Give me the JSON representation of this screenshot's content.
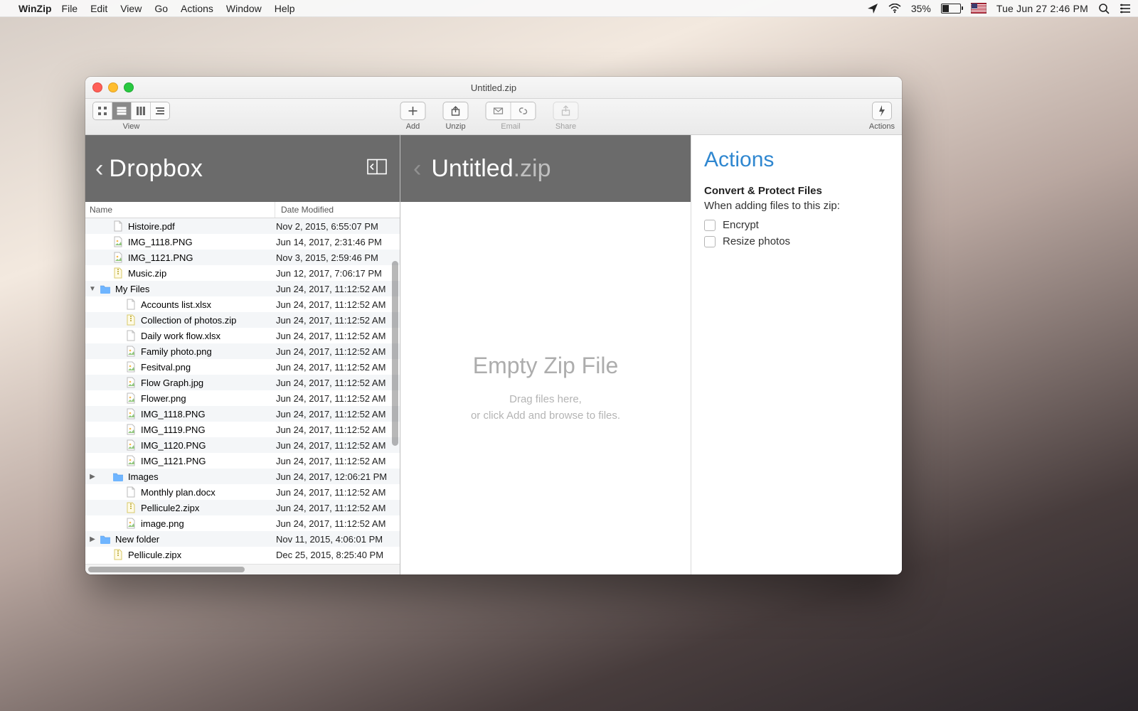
{
  "menubar": {
    "app": "WinZip",
    "items": [
      "File",
      "Edit",
      "View",
      "Go",
      "Actions",
      "Window",
      "Help"
    ],
    "battery_pct": "35%",
    "clock": "Tue Jun 27  2:46 PM"
  },
  "window": {
    "title": "Untitled.zip",
    "toolbar": {
      "view_label": "View",
      "add_label": "Add",
      "unzip_label": "Unzip",
      "email_label": "Email",
      "share_label": "Share",
      "actions_label": "Actions"
    },
    "browser": {
      "location": "Dropbox",
      "columns": {
        "name": "Name",
        "date": "Date Modified"
      },
      "rows": [
        {
          "indent": 1,
          "icon": "doc",
          "name": "Histoire.pdf",
          "date": "Nov 2, 2015, 6:55:07 PM"
        },
        {
          "indent": 1,
          "icon": "img",
          "name": "IMG_1118.PNG",
          "date": "Jun 14, 2017, 2:31:46 PM"
        },
        {
          "indent": 1,
          "icon": "img",
          "name": "IMG_1121.PNG",
          "date": "Nov 3, 2015, 2:59:46 PM"
        },
        {
          "indent": 1,
          "icon": "zip",
          "name": "Music.zip",
          "date": "Jun 12, 2017, 7:06:17 PM"
        },
        {
          "indent": 0,
          "disclosure": "down",
          "icon": "folder",
          "name": "My Files",
          "date": "Jun 24, 2017, 11:12:52 AM"
        },
        {
          "indent": 2,
          "icon": "doc",
          "name": "Accounts list.xlsx",
          "date": "Jun 24, 2017, 11:12:52 AM"
        },
        {
          "indent": 2,
          "icon": "zip",
          "name": "Collection of photos.zip",
          "date": "Jun 24, 2017, 11:12:52 AM"
        },
        {
          "indent": 2,
          "icon": "doc",
          "name": "Daily work flow.xlsx",
          "date": "Jun 24, 2017, 11:12:52 AM"
        },
        {
          "indent": 2,
          "icon": "img",
          "name": "Family photo.png",
          "date": "Jun 24, 2017, 11:12:52 AM"
        },
        {
          "indent": 2,
          "icon": "img",
          "name": "Fesitval.png",
          "date": "Jun 24, 2017, 11:12:52 AM"
        },
        {
          "indent": 2,
          "icon": "img",
          "name": "Flow Graph.jpg",
          "date": "Jun 24, 2017, 11:12:52 AM"
        },
        {
          "indent": 2,
          "icon": "img",
          "name": "Flower.png",
          "date": "Jun 24, 2017, 11:12:52 AM"
        },
        {
          "indent": 2,
          "icon": "img",
          "name": "IMG_1118.PNG",
          "date": "Jun 24, 2017, 11:12:52 AM"
        },
        {
          "indent": 2,
          "icon": "img",
          "name": "IMG_1119.PNG",
          "date": "Jun 24, 2017, 11:12:52 AM"
        },
        {
          "indent": 2,
          "icon": "img",
          "name": "IMG_1120.PNG",
          "date": "Jun 24, 2017, 11:12:52 AM"
        },
        {
          "indent": 2,
          "icon": "img",
          "name": "IMG_1121.PNG",
          "date": "Jun 24, 2017, 11:12:52 AM"
        },
        {
          "indent": 1,
          "disclosure": "right",
          "icon": "folder",
          "name": "Images",
          "date": "Jun 24, 2017, 12:06:21 PM"
        },
        {
          "indent": 2,
          "icon": "doc",
          "name": "Monthly plan.docx",
          "date": "Jun 24, 2017, 11:12:52 AM"
        },
        {
          "indent": 2,
          "icon": "zip",
          "name": "Pellicule2.zipx",
          "date": "Jun 24, 2017, 11:12:52 AM"
        },
        {
          "indent": 2,
          "icon": "img",
          "name": "image.png",
          "date": "Jun 24, 2017, 11:12:52 AM"
        },
        {
          "indent": 0,
          "disclosure": "right",
          "icon": "folder",
          "name": "New folder",
          "date": "Nov 11, 2015, 4:06:01 PM"
        },
        {
          "indent": 1,
          "icon": "zip",
          "name": "Pellicule.zipx",
          "date": "Dec 25, 2015, 8:25:40 PM"
        }
      ]
    },
    "zip": {
      "name": "Untitled",
      "ext": ".zip",
      "empty_title": "Empty Zip File",
      "empty_line1": "Drag files here,",
      "empty_line2": "or click Add and browse to files."
    },
    "actions": {
      "heading": "Actions",
      "subtitle": "Convert & Protect Files",
      "desc": "When adding files to this zip:",
      "encrypt": "Encrypt",
      "resize": "Resize photos"
    }
  }
}
